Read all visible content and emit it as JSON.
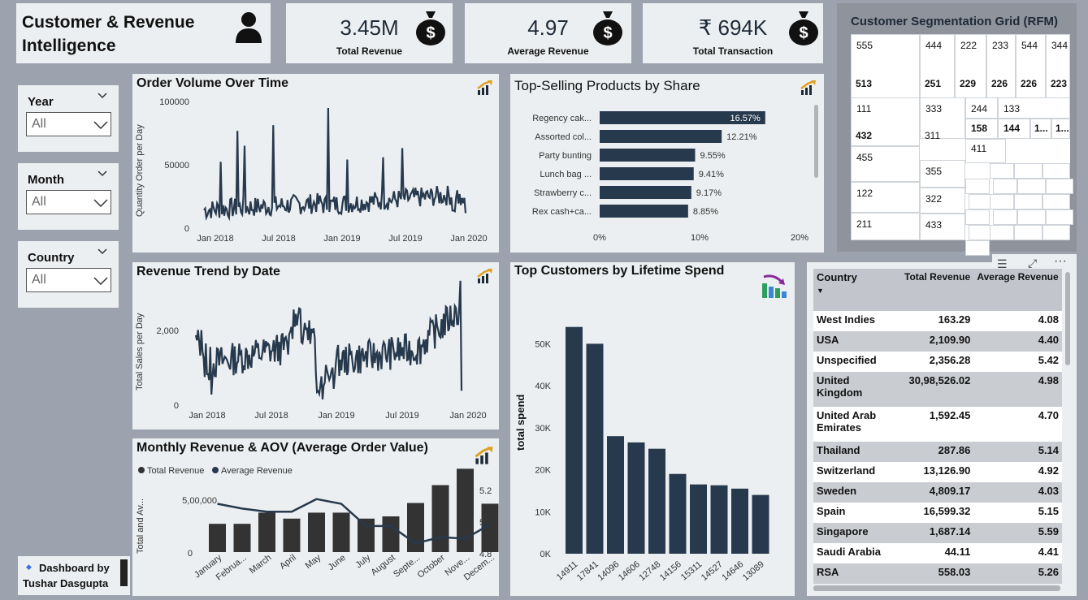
{
  "header": {
    "title_line1": "Customer & Revenue",
    "title_line2": "Intelligence"
  },
  "kpis": [
    {
      "value": "3.45M",
      "label": "Total Revenue"
    },
    {
      "value": "4.97",
      "label": "Average Revenue"
    },
    {
      "value": "₹ 694K",
      "label": "Total Transaction"
    }
  ],
  "slicers": [
    {
      "title": "Year",
      "value": "All"
    },
    {
      "title": "Month",
      "value": "All"
    },
    {
      "title": "Country",
      "value": "All"
    }
  ],
  "credit": {
    "line1": "Dashboard by",
    "line2": "Tushar Dasgupta"
  },
  "colors": {
    "bar": "#27394d",
    "bg": "#9da2af",
    "card": "#eceff1"
  },
  "chart_data": [
    {
      "type": "line",
      "title": "Order Volume Over Time",
      "ylabel": "Quantity Order per Day",
      "x_ticks": [
        "Jan 2018",
        "Jul 2018",
        "Jan 2019",
        "Jul 2019",
        "Jan 2020"
      ],
      "y_ticks": [
        "0",
        "50000",
        "100000"
      ],
      "ylim": [
        0,
        110000
      ]
    },
    {
      "type": "bar",
      "title": "Top-Selling Products by Share",
      "categories": [
        "Regency cak...",
        "Assorted col...",
        "Party bunting",
        "Lunch bag ...",
        "Strawberry c...",
        "Rex cash+ca..."
      ],
      "values": [
        16.57,
        12.21,
        9.55,
        9.41,
        9.17,
        8.85
      ],
      "value_labels": [
        "16.57%",
        "12.21%",
        "9.55%",
        "9.41%",
        "9.17%",
        "8.85%"
      ],
      "x_ticks": [
        "0%",
        "10%",
        "20%"
      ],
      "xlim": [
        0,
        20
      ]
    },
    {
      "type": "line",
      "title": "Revenue Trend by Date",
      "ylabel": "Total Sales per Day",
      "x_ticks": [
        "Jan 2018",
        "Jul 2018",
        "Jan 2019",
        "Jul 2019",
        "Jan 2020"
      ],
      "y_ticks": [
        "0",
        "2,000"
      ],
      "ylim": [
        0,
        2800
      ]
    },
    {
      "type": "bar",
      "title": "Monthly Revenue & AOV (Average Order Value)",
      "legend": [
        "Total Revenue",
        "Average Revenue"
      ],
      "ylabel": "Total and Av...",
      "categories": [
        "January",
        "Februa...",
        "March",
        "April",
        "May",
        "June",
        "July",
        "August",
        "Septe...",
        "October",
        "Nove...",
        "Decem..."
      ],
      "series": [
        {
          "name": "Total Revenue",
          "values": [
            190000,
            190000,
            265000,
            225000,
            265000,
            265000,
            225000,
            240000,
            330000,
            450000,
            560000,
            325000
          ]
        },
        {
          "name": "Average Revenue",
          "values": [
            5.11,
            5.08,
            5.06,
            5.06,
            5.14,
            5.11,
            4.97,
            4.97,
            4.86,
            4.9,
            4.89,
            4.98
          ]
        }
      ],
      "y_ticks": [
        "0",
        "5,00,000"
      ],
      "y2_ticks": [
        "4.8",
        "5.0",
        "5.2"
      ]
    },
    {
      "type": "bar",
      "title": "Top Customers by Lifetime Spend",
      "ylabel": "total spend",
      "categories": [
        "14911",
        "17841",
        "14096",
        "14606",
        "12748",
        "14156",
        "15311",
        "14527",
        "14646",
        "13089"
      ],
      "values": [
        54000,
        50000,
        28000,
        26500,
        25000,
        19000,
        16500,
        16300,
        15500,
        14000
      ],
      "y_ticks": [
        "0K",
        "10K",
        "20K",
        "30K",
        "40K",
        "50K"
      ],
      "ylim": [
        0,
        58000
      ]
    }
  ],
  "rfm": {
    "title": "Customer Segmentation Grid (RFM)",
    "cells": [
      "555",
      "444",
      "222",
      "233",
      "544",
      "344",
      "513",
      "251",
      "229",
      "226",
      "226",
      "223",
      "111",
      "333",
      "244",
      "133",
      "158",
      "144",
      "1...",
      "1...",
      "432",
      "311",
      "411",
      "455",
      "355",
      "122",
      "322",
      "211",
      "433"
    ]
  },
  "country_table": {
    "headers": [
      "Country",
      "Total Revenue",
      "Average Revenue"
    ],
    "rows": [
      [
        "West Indies",
        "163.29",
        "4.08"
      ],
      [
        "USA",
        "2,109.90",
        "4.40"
      ],
      [
        "Unspecified",
        "2,356.28",
        "5.42"
      ],
      [
        "United Kingdom",
        "30,98,526.02",
        "4.98"
      ],
      [
        "United Arab Emirates",
        "1,592.45",
        "4.70"
      ],
      [
        "Thailand",
        "287.86",
        "5.14"
      ],
      [
        "Switzerland",
        "13,126.90",
        "4.92"
      ],
      [
        "Sweden",
        "4,809.17",
        "4.03"
      ],
      [
        "Spain",
        "16,599.32",
        "5.15"
      ],
      [
        "Singapore",
        "1,687.14",
        "5.59"
      ],
      [
        "Saudi Arabia",
        "44.11",
        "4.41"
      ],
      [
        "RSA",
        "558.03",
        "5.26"
      ]
    ]
  }
}
